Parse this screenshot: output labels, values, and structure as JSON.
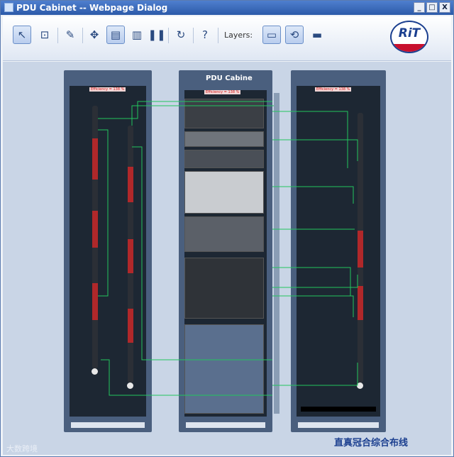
{
  "window": {
    "title": "PDU Cabinet -- Webpage Dialog",
    "minimize": "_",
    "maximize": "□",
    "close": "X"
  },
  "toolbar": {
    "tools": [
      {
        "icon": "pointer-icon",
        "glyph": "↖",
        "active": true
      },
      {
        "icon": "zoom-region-icon",
        "glyph": "⊡",
        "active": false
      },
      {
        "icon": "pencil-icon",
        "glyph": "✎",
        "active": false
      },
      {
        "icon": "pan-icon",
        "glyph": "✥",
        "active": false
      },
      {
        "icon": "cabinet-view-icon",
        "glyph": "▤",
        "active": true
      },
      {
        "icon": "book-icon",
        "glyph": "▥",
        "active": false
      },
      {
        "icon": "pause-icon",
        "glyph": "❚❚",
        "active": false
      },
      {
        "icon": "refresh-icon",
        "glyph": "↻",
        "active": false
      },
      {
        "icon": "help-icon",
        "glyph": "?",
        "active": false
      }
    ],
    "layers_label": "Layers:",
    "layer_tools": [
      {
        "icon": "layer-save-icon",
        "glyph": "▭",
        "active": true
      },
      {
        "icon": "layer-refresh-icon",
        "glyph": "⟲",
        "active": true
      },
      {
        "icon": "layer-eraser-icon",
        "glyph": "▬",
        "active": false
      }
    ],
    "logo": "RiT"
  },
  "cabinets": {
    "left": {
      "efficiency": "Efficiency = 138 %"
    },
    "center": {
      "title": "PDU Cabine",
      "efficiency": "Efficiency = 138 %"
    },
    "right": {
      "efficiency": "Efficiency = 138 %"
    }
  },
  "colors": {
    "wire": "#22c55e",
    "pdu_outlet": "#b0282a",
    "cabinet_frame": "#4a5f7e",
    "cabinet_interior": "#1d2733"
  },
  "watermark": {
    "left": "大数跨境",
    "right": "直真冠合综合布线"
  }
}
